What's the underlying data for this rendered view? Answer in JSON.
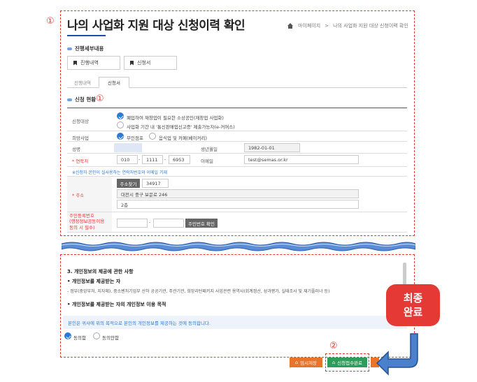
{
  "annotations": {
    "marker1": "①",
    "marker2": "②",
    "badge_line1": "최종",
    "badge_line2": "완료"
  },
  "page": {
    "title": "나의 사업화 지원 대상 신청이력 확인"
  },
  "breadcrumb": {
    "items": [
      "마이페이지",
      ">",
      "나의 사업화 지원 대상 신청이력 확인"
    ]
  },
  "detail_section": {
    "heading": "진행세부내용",
    "buttons": [
      "진행내역",
      "신청서"
    ]
  },
  "tabs": [
    {
      "label": "진행내역"
    },
    {
      "label": "신청서"
    }
  ],
  "status_section": {
    "heading": "신청 현황"
  },
  "form": {
    "target_label": "신청대상",
    "target_options": [
      "폐업하여 재창업이 필요한 소상공인(재창업 사업화)",
      "사업화 기간 내 '통신판매업신고증' 제출가능자(e-커머스)"
    ],
    "business_label": "희망사업",
    "business_options": [
      "무인점포",
      "음식업 및 카페(베이커리)"
    ],
    "name_label": "성명",
    "birth_label": "생년월일",
    "birth_value": "1982-01-01",
    "phone_label": "* 연락처",
    "phone": [
      "010",
      "1111",
      "6953"
    ],
    "phone_sep": "-",
    "email_label": "이메일",
    "email_value": "test@semas.or.kr",
    "contact_note": "※신청자 본인이 실사용하는 연락처번호와 이메일 기재",
    "address_label": "* 주소",
    "address_button": "주소찾기",
    "zip": "34917",
    "address1": "대전시 중구 보문로 246",
    "address2": "2층",
    "resident_label_lines": [
      "주민등록번호",
      "(행정정보공동이용",
      "동의 시 필수)"
    ],
    "resident_sep": "-",
    "resident_button": "주민번호 확인"
  },
  "consent": {
    "title": "3. 개인정보의 제공에 관한 사항",
    "sub1": "• 개인정보를 제공받는 자",
    "sub1_text": "-     정부(중앙부처, 지자체), 중소벤처기업부 산하 공공기관, 주관기관, 희망리턴패키지 사업관련 용역사(회계정산, 성과평가, 실태조사 및 재기플러너 등)",
    "sub2": "• 개인정보를 제공받는 자의 개인정보 이용 목적",
    "agree_text": "본인은 귀사에 위의 목적으로 본인의 개인정보를 제공하는 것에 동의합니다.",
    "options": [
      "동의함",
      "동의안함"
    ]
  },
  "actions": {
    "save_label": "임시저장",
    "submit_label": "신청접수완료"
  },
  "colors": {
    "accent": "#1e4fa3",
    "annotation_red": "#e53935",
    "save_orange": "#e8732a",
    "submit_green": "#2e9d5b"
  }
}
